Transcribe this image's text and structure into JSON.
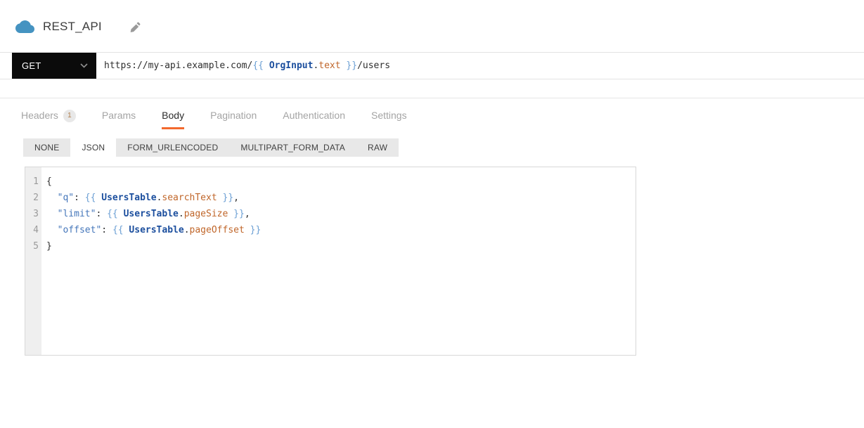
{
  "header": {
    "title": "REST_API"
  },
  "request_bar": {
    "method": "GET",
    "url_segments": [
      {
        "text": "https://my-api.example.com/",
        "type": "plain"
      },
      {
        "text": "{{ ",
        "type": "brace"
      },
      {
        "text": "OrgInput",
        "type": "entity"
      },
      {
        "text": ".",
        "type": "plain"
      },
      {
        "text": "text",
        "type": "property"
      },
      {
        "text": " }}",
        "type": "brace"
      },
      {
        "text": "/users",
        "type": "plain"
      }
    ]
  },
  "tabs": [
    {
      "label": "Headers",
      "badge": "1",
      "active": false
    },
    {
      "label": "Params",
      "active": false
    },
    {
      "label": "Body",
      "active": true
    },
    {
      "label": "Pagination",
      "active": false
    },
    {
      "label": "Authentication",
      "active": false
    },
    {
      "label": "Settings",
      "active": false
    }
  ],
  "body_type_tabs": [
    {
      "label": "NONE",
      "active": false
    },
    {
      "label": "JSON",
      "active": true
    },
    {
      "label": "FORM_URLENCODED",
      "active": false
    },
    {
      "label": "MULTIPART_FORM_DATA",
      "active": false
    },
    {
      "label": "RAW",
      "active": false
    }
  ],
  "editor": {
    "lines": [
      {
        "number": "1",
        "segments": [
          {
            "text": "{",
            "type": "plain"
          }
        ]
      },
      {
        "number": "2",
        "segments": [
          {
            "text": "  ",
            "type": "plain"
          },
          {
            "text": "\"q\"",
            "type": "key"
          },
          {
            "text": ": ",
            "type": "plain"
          },
          {
            "text": "{{ ",
            "type": "brace"
          },
          {
            "text": "UsersTable",
            "type": "entity"
          },
          {
            "text": ".",
            "type": "plain"
          },
          {
            "text": "searchText",
            "type": "property"
          },
          {
            "text": " }}",
            "type": "brace"
          },
          {
            "text": ",",
            "type": "plain"
          }
        ]
      },
      {
        "number": "3",
        "segments": [
          {
            "text": "  ",
            "type": "plain"
          },
          {
            "text": "\"limit\"",
            "type": "key"
          },
          {
            "text": ": ",
            "type": "plain"
          },
          {
            "text": "{{ ",
            "type": "brace"
          },
          {
            "text": "UsersTable",
            "type": "entity"
          },
          {
            "text": ".",
            "type": "plain"
          },
          {
            "text": "pageSize",
            "type": "property"
          },
          {
            "text": " }}",
            "type": "brace"
          },
          {
            "text": ",",
            "type": "plain"
          }
        ]
      },
      {
        "number": "4",
        "segments": [
          {
            "text": "  ",
            "type": "plain"
          },
          {
            "text": "\"offset\"",
            "type": "key"
          },
          {
            "text": ": ",
            "type": "plain"
          },
          {
            "text": "{{ ",
            "type": "brace"
          },
          {
            "text": "UsersTable",
            "type": "entity"
          },
          {
            "text": ".",
            "type": "plain"
          },
          {
            "text": "pageOffset",
            "type": "property"
          },
          {
            "text": " }}",
            "type": "brace"
          }
        ]
      },
      {
        "number": "5",
        "segments": [
          {
            "text": "}",
            "type": "plain"
          }
        ]
      }
    ]
  },
  "icons": {
    "cloud": "cloud-icon",
    "edit": "pencil-icon",
    "method_chevron": "chevron-down-icon"
  },
  "colors": {
    "accent_orange": "#f3692e",
    "method_dropdown_bg": "#0b0b0b",
    "cloud_blue": "#4593c1",
    "syntax_brace": "#6b9fd4",
    "syntax_entity": "#1c4f9e",
    "syntax_property": "#c0662a",
    "syntax_key": "#4476ba",
    "badge_text": "#b07c49",
    "subtab_bg": "#e8e8e8"
  }
}
